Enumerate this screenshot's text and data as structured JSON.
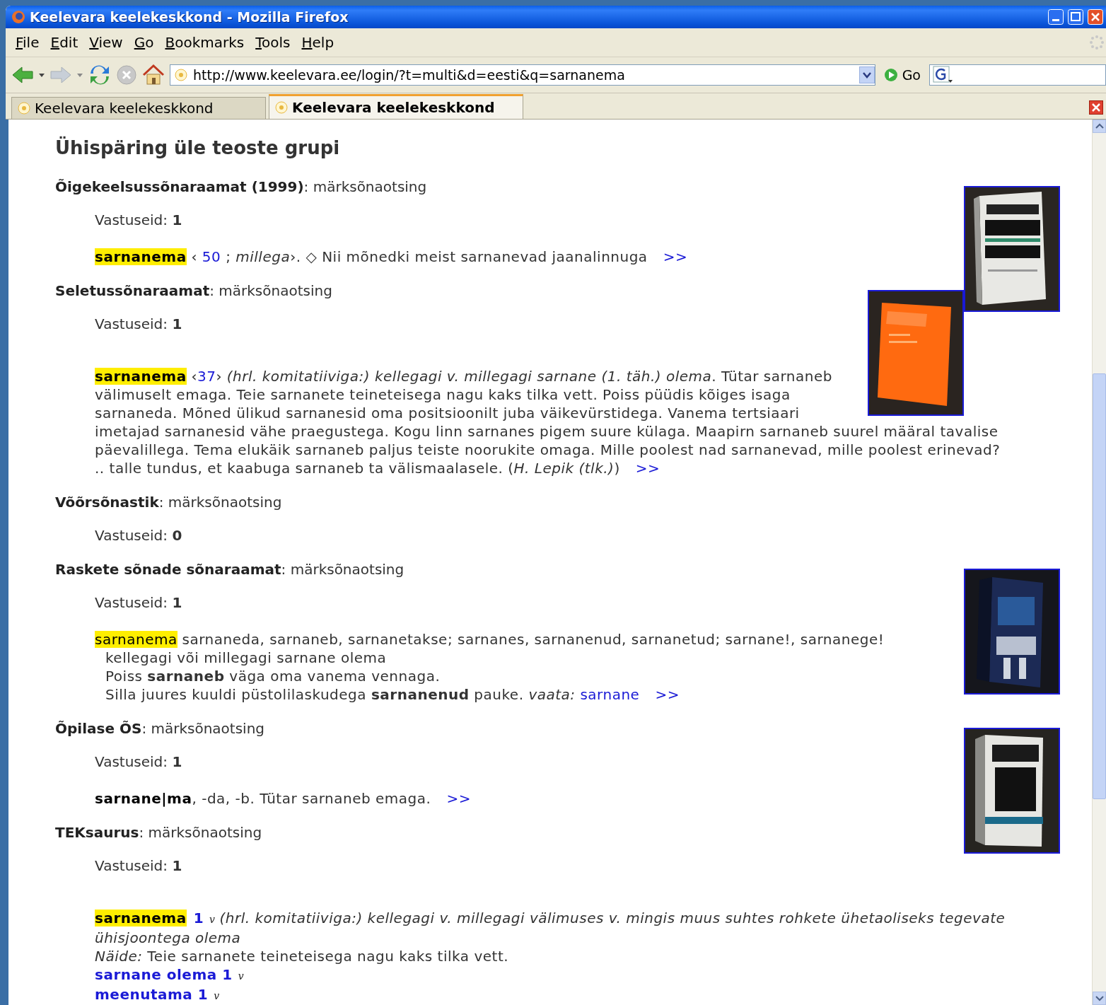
{
  "browser": {
    "title": "Keelevara keelekeskkond - Mozilla Firefox",
    "menu": [
      "File",
      "Edit",
      "View",
      "Go",
      "Bookmarks",
      "Tools",
      "Help"
    ],
    "url": "http://www.keelevara.ee/login/?t=multi&d=eesti&q=sarnanema",
    "go_label": "Go",
    "tabs": [
      {
        "label": "Keelevara keelekeskkond",
        "selected": false
      },
      {
        "label": "Keelevara keelekeskkond",
        "selected": true
      }
    ]
  },
  "page": {
    "title": "Ühispäring üle teoste grupi",
    "sections": [
      {
        "heading": "**Õigekeelsussõnaraamat (1999)**: märksõnaotsing",
        "results": "Vastuseid: **1**",
        "entry": {
          "kind": "inline",
          "lines": [
            {
              "indented": false,
              "segments": [
                {
                  "kind": "head",
                  "text": "sarnanema"
                },
                {
                  "kind": "text",
                  "text": " ‹ "
                },
                {
                  "kind": "ref",
                  "text": "50"
                },
                {
                  "kind": "text",
                  "text": " ; *millega*›. ◇ Nii mõnedki meist sarnanevad jaanalinnuga"
                },
                {
                  "kind": "more",
                  "text": ">>"
                }
              ]
            }
          ]
        }
      },
      {
        "heading": "**Seletussõnaraamat**: märksõnaotsing",
        "results": "Vastuseid: **1**",
        "entry": {
          "kind": "block",
          "lines": [
            {
              "indented": false,
              "segments": [
                {
                  "kind": "head",
                  "text": "sarnanema"
                },
                {
                  "kind": "text",
                  "text": " ‹"
                },
                {
                  "kind": "ref",
                  "text": "37"
                },
                {
                  "kind": "text",
                  "text": "› *(hrl. komitatiiviga:) kellegagi v. millegagi sarnane (1. täh.) olema*. Tütar sarnaneb välimuselt emaga. Teie sarnanete teineteisega nagu kaks tilka vett. Poiss püüdis kõiges isaga sarnaneda. Mõned ülikud sarnanesid oma positsioonilt juba väikevürstidega. Vanema tertsiaari imetajad sarnanesid vähe praegustega. Kogu linn sarnanes pigem suure külaga. Maapirn sarnaneb suurel määral tavalise päevalillega. Tema elukäik sarnaneb paljus teiste noorukite omaga. Mille poolest nad sarnanevad, mille poolest erinevad? .. talle tundus, et kaabuga sarnaneb ta välismaalasele. (*H. Lepik (tlk.)*)"
                },
                {
                  "kind": "more",
                  "text": ">>"
                }
              ]
            }
          ]
        }
      },
      {
        "heading": "**Võõrsõnastik**: märksõnaotsing",
        "results": "Vastuseid: **0**"
      },
      {
        "heading": "**Raskete sõnade sõnaraamat**: märksõnaotsing",
        "results": "Vastuseid: **1**",
        "entry": {
          "kind": "inline",
          "lines": [
            {
              "indented": false,
              "segments": [
                {
                  "kind": "mark",
                  "text": "sarnanema"
                },
                {
                  "kind": "text",
                  "text": " sarnaneda, sarnaneb, sarnanetakse; sarnanes, sarnanenud, sarnanetud; sarnane!, sarnanege!"
                }
              ]
            },
            {
              "indented": true,
              "segments": [
                {
                  "kind": "text",
                  "text": "kellegagi või millegagi sarnane olema"
                }
              ]
            },
            {
              "indented": true,
              "segments": [
                {
                  "kind": "text",
                  "text": "Poiss **sarnaneb** väga oma vanema vennaga."
                }
              ]
            },
            {
              "indented": true,
              "segments": [
                {
                  "kind": "text",
                  "text": "Silla juures kuuldi püstolilaskudega **sarnanenud** pauke. *vaata:* "
                },
                {
                  "kind": "ref",
                  "text": "sarnane"
                },
                {
                  "kind": "more",
                  "text": ">>"
                }
              ]
            }
          ]
        }
      },
      {
        "heading": "**Õpilase ÕS**: märksõnaotsing",
        "results": "Vastuseid: **1**",
        "entry": {
          "kind": "inline",
          "lines": [
            {
              "indented": false,
              "segments": [
                {
                  "kind": "bold",
                  "text": "sarnane|ma"
                },
                {
                  "kind": "text",
                  "text": ", -da, -b. Tütar sarnaneb emaga."
                },
                {
                  "kind": "more",
                  "text": ">>"
                }
              ]
            }
          ]
        }
      },
      {
        "heading": "**TEKsaurus**: märksõnaotsing",
        "results": "Vastuseid: **1**",
        "entry": {
          "kind": "block",
          "lines": [
            {
              "indented": false,
              "segments": [
                {
                  "kind": "head",
                  "text": "sarnanema"
                },
                {
                  "kind": "number",
                  "text": "1"
                },
                {
                  "kind": "pos",
                  "text": "v"
                },
                {
                  "kind": "text",
                  "text": "*(hrl. komitatiiviga:) kellegagi v. millegagi välimuses v. mingis muus suhtes rohkete ühetaoliseks tegevate ühisjoontega olema*"
                }
              ]
            },
            {
              "indented": false,
              "segments": [
                {
                  "kind": "text",
                  "text": "*Näide:* Teie sarnanete teineteisega nagu kaks tilka vett."
                }
              ]
            },
            {
              "indented": false,
              "segments": [
                {
                  "kind": "term",
                  "text": "sarnane olema 1"
                },
                {
                  "kind": "pos",
                  "text": "v"
                }
              ]
            },
            {
              "indented": false,
              "segments": [
                {
                  "kind": "term",
                  "text": "meenutama 1"
                },
                {
                  "kind": "pos",
                  "text": "v"
                }
              ]
            }
          ]
        }
      }
    ]
  }
}
